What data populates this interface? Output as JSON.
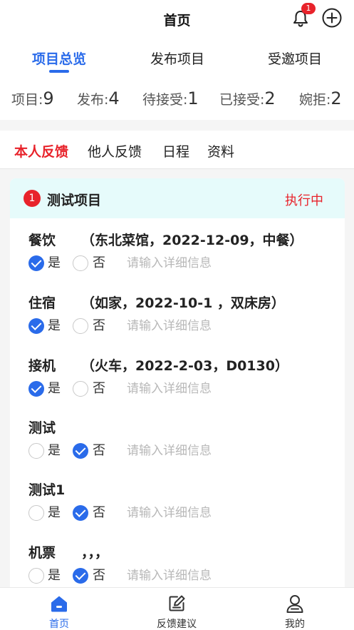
{
  "header": {
    "title": "首页",
    "notification_count": "1"
  },
  "top_tabs": [
    {
      "label": "项目总览",
      "active": true
    },
    {
      "label": "发布项目",
      "active": false
    },
    {
      "label": "受邀项目",
      "active": false
    }
  ],
  "stats": [
    {
      "label": "项目:",
      "value": "9"
    },
    {
      "label": "发布:",
      "value": "4"
    },
    {
      "label": "待接受:",
      "value": "1"
    },
    {
      "label": "已接受:",
      "value": "2"
    },
    {
      "label": "婉拒:",
      "value": "2"
    }
  ],
  "sub_tabs": [
    {
      "label": "本人反馈",
      "active": true
    },
    {
      "label": "他人反馈",
      "active": false
    },
    {
      "label": "日程",
      "active": false
    },
    {
      "label": "资料",
      "active": false
    }
  ],
  "project": {
    "index": "1",
    "title": "测试项目",
    "status": "执行中",
    "yes_label": "是",
    "no_label": "否",
    "input_placeholder": "请输入详细信息",
    "items": [
      {
        "label": "餐饮",
        "detail": "（东北菜馆，2022-12-09，中餐）",
        "answer": "yes"
      },
      {
        "label": "住宿",
        "detail": "（如家，2022-10-1 ，双床房）",
        "answer": "yes"
      },
      {
        "label": "接机",
        "detail": "（火车，2022-2-03，D0130）",
        "answer": "yes"
      },
      {
        "label": "测试",
        "detail": "",
        "answer": "no"
      },
      {
        "label": "测试1",
        "detail": "",
        "answer": "no"
      },
      {
        "label": "机票",
        "detail": "，，，",
        "answer": "no"
      }
    ]
  },
  "bottom_nav": [
    {
      "label": "首页",
      "icon": "home-icon",
      "active": true
    },
    {
      "label": "反馈建议",
      "icon": "edit-feedback-icon",
      "active": false
    },
    {
      "label": "我的",
      "icon": "user-icon",
      "active": false
    }
  ],
  "colors": {
    "accent": "#2a6bea",
    "danger": "#e8232b",
    "card_header_bg": "#e6fbfb"
  }
}
